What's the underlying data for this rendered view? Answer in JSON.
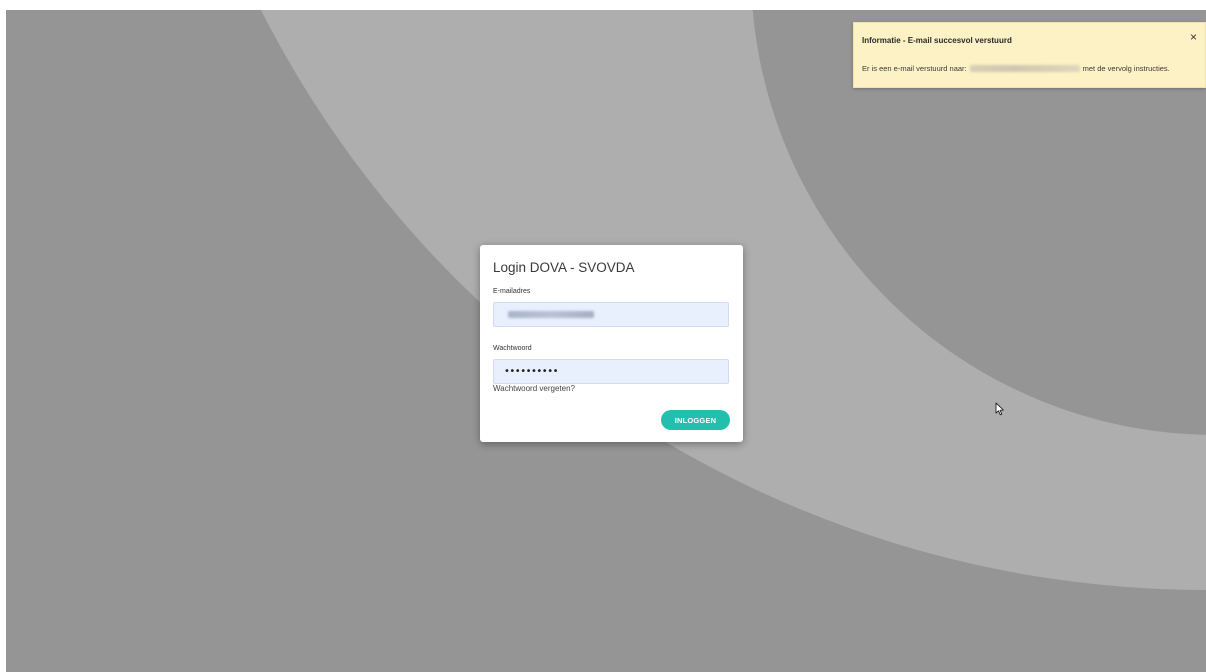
{
  "notification": {
    "title": "Informatie - E-mail succesvol verstuurd",
    "close_symbol": "×",
    "message_prefix": "Er is een e-mail verstuurd naar:",
    "message_suffix": "met de vervolg instructies.",
    "background_color": "#fdf1c6"
  },
  "login": {
    "title": "Login DOVA - SVOVDA",
    "email_label": "E-mailadres",
    "password_label": "Wachtwoord",
    "password_value": "••••••••••",
    "forgot_password_link": "Wachtwoord vergeten?",
    "submit_label": "INLOGGEN",
    "accent_color": "#23bfae",
    "input_background": "#e8f0fe"
  },
  "background": {
    "colors": [
      "#959595",
      "#aeaeae"
    ]
  }
}
